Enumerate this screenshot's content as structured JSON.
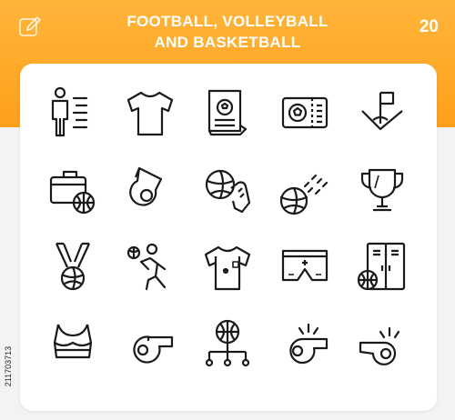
{
  "header": {
    "title_line1": "FOOTBALL, VOLLEYBALL",
    "title_line2": "AND BASKETBALL",
    "count": "20",
    "accent_color": "#ff9f1c"
  },
  "stock_id": "211703713",
  "icons": [
    "player-speed-icon",
    "jersey-shirt-icon",
    "sports-newspaper-icon",
    "match-ticket-icon",
    "corner-flag-icon",
    "sports-bag-basketball-icon",
    "whistle-icon",
    "hand-holding-ball-icon",
    "flying-volleyball-icon",
    "trophy-cup-icon",
    "medal-volleyball-icon",
    "volleyball-player-icon",
    "referee-shirt-icon",
    "sports-shorts-icon",
    "locker-basketball-icon",
    "sports-bra-icon",
    "whistle-side-icon",
    "basketball-strategy-icon",
    "blowing-whistle-icon",
    "loud-whistle-icon"
  ]
}
